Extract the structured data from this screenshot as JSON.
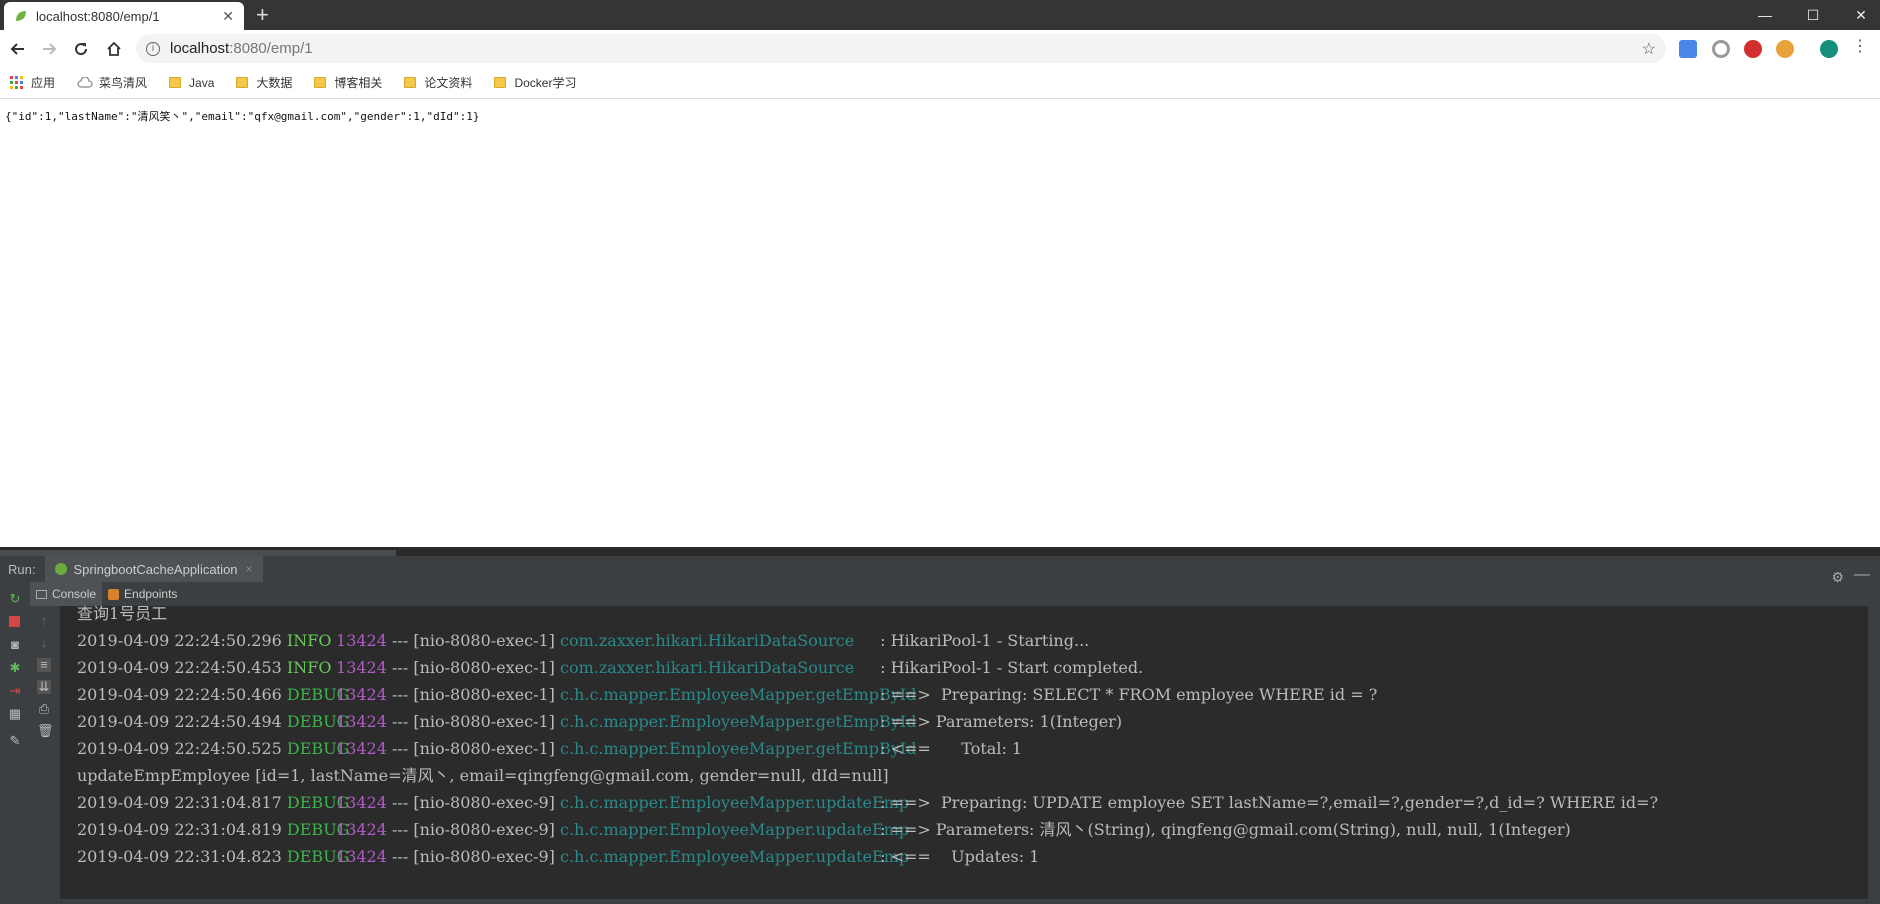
{
  "browser": {
    "tab_title": "localhost:8080/emp/1",
    "tab_close": "✕",
    "new_tab": "+",
    "url_host": "localhost",
    "url_path": ":8080/emp/1",
    "window_controls": [
      "—",
      "☐",
      "✕"
    ]
  },
  "bookmarks": [
    {
      "label": "应用",
      "icon": "apps-icon"
    },
    {
      "label": "菜鸟清风",
      "icon": "cloud-icon"
    },
    {
      "label": "Java",
      "icon": "folder-icon"
    },
    {
      "label": "大数据",
      "icon": "folder-icon"
    },
    {
      "label": "博客相关",
      "icon": "folder-icon"
    },
    {
      "label": "论文资料",
      "icon": "folder-icon"
    },
    {
      "label": "Docker学习",
      "icon": "folder-icon"
    }
  ],
  "page": {
    "json_text": "{\"id\":1,\"lastName\":\"清风笑丶\",\"email\":\"qfx@gmail.com\",\"gender\":1,\"dId\":1}"
  },
  "ide": {
    "run_label": "Run:",
    "run_tab": "SpringbootCacheApplication",
    "run_tab_close": "×",
    "console_tab": "Console",
    "endpoints_tab": "Endpoints",
    "colors": {
      "info": "#6ac75a",
      "debug": "#3fb24e",
      "pid": "#b05cc4",
      "logger": "#2a8a8a"
    },
    "console_lines": [
      {
        "plain": "查询1号员工"
      },
      {
        "ts": "2019-04-09 22:24:50.296",
        "level": "INFO",
        "pid": "13424",
        "thread": "--- [nio-8080-exec-1]",
        "logger": "com.zaxxer.hikari.HikariDataSource",
        "msg": ": HikariPool-1 - Starting..."
      },
      {
        "ts": "2019-04-09 22:24:50.453",
        "level": "INFO",
        "pid": "13424",
        "thread": "--- [nio-8080-exec-1]",
        "logger": "com.zaxxer.hikari.HikariDataSource",
        "msg": ": HikariPool-1 - Start completed."
      },
      {
        "ts": "2019-04-09 22:24:50.466",
        "level": "DEBUG",
        "pid": "13424",
        "thread": "--- [nio-8080-exec-1]",
        "logger": "c.h.c.mapper.EmployeeMapper.getEmpById",
        "msg": ": ==>  Preparing: SELECT * FROM employee WHERE id = ?"
      },
      {
        "ts": "2019-04-09 22:24:50.494",
        "level": "DEBUG",
        "pid": "13424",
        "thread": "--- [nio-8080-exec-1]",
        "logger": "c.h.c.mapper.EmployeeMapper.getEmpById",
        "msg": ": ==> Parameters: 1(Integer)"
      },
      {
        "ts": "2019-04-09 22:24:50.525",
        "level": "DEBUG",
        "pid": "13424",
        "thread": "--- [nio-8080-exec-1]",
        "logger": "c.h.c.mapper.EmployeeMapper.getEmpById",
        "msg": ": <==      Total: 1"
      },
      {
        "plain": "updateEmpEmployee [id=1, lastName=清风丶, email=qingfeng@gmail.com, gender=null, dId=null]"
      },
      {
        "ts": "2019-04-09 22:31:04.817",
        "level": "DEBUG",
        "pid": "13424",
        "thread": "--- [nio-8080-exec-9]",
        "logger": "c.h.c.mapper.EmployeeMapper.updateEmp",
        "msg": ": ==>  Preparing: UPDATE employee SET lastName=?,email=?,gender=?,d_id=? WHERE id=?"
      },
      {
        "ts": "2019-04-09 22:31:04.819",
        "level": "DEBUG",
        "pid": "13424",
        "thread": "--- [nio-8080-exec-9]",
        "logger": "c.h.c.mapper.EmployeeMapper.updateEmp",
        "msg": ": ==> Parameters: 清风丶(String), qingfeng@gmail.com(String), null, null, 1(Integer)"
      },
      {
        "ts": "2019-04-09 22:31:04.823",
        "level": "DEBUG",
        "pid": "13424",
        "thread": "--- [nio-8080-exec-9]",
        "logger": "c.h.c.mapper.EmployeeMapper.updateEmp",
        "msg": ": <==    Updates: 1"
      }
    ]
  }
}
